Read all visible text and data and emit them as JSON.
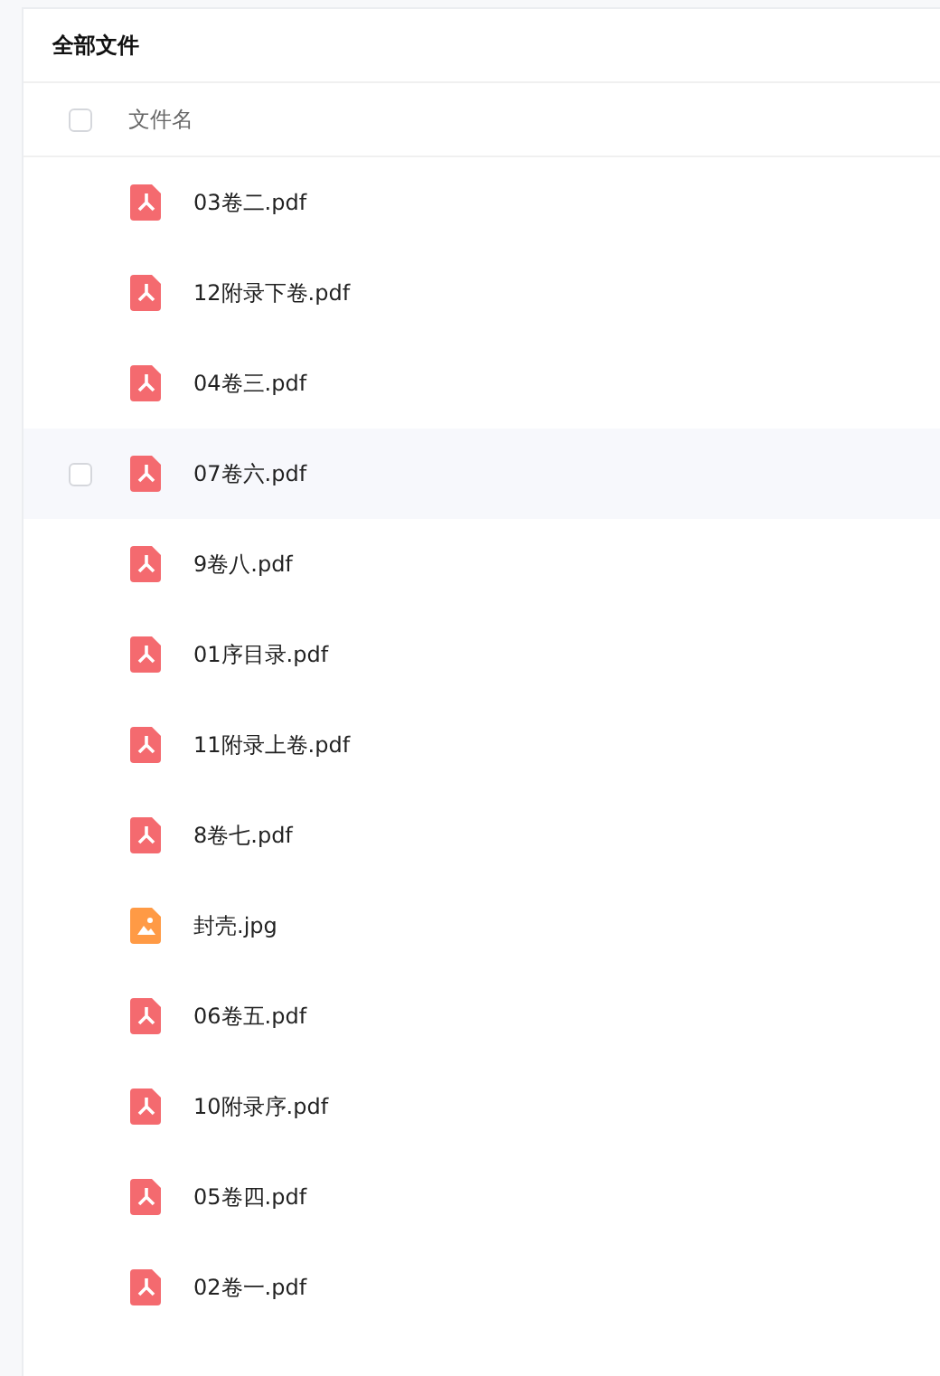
{
  "title": "全部文件",
  "header": {
    "checked": false,
    "column": "文件名"
  },
  "files": [
    {
      "name": "03卷二.pdf",
      "kind": "pdf",
      "hovered": false
    },
    {
      "name": "12附录下卷.pdf",
      "kind": "pdf",
      "hovered": false
    },
    {
      "name": "04卷三.pdf",
      "kind": "pdf",
      "hovered": false
    },
    {
      "name": "07卷六.pdf",
      "kind": "pdf",
      "hovered": true
    },
    {
      "name": "9卷八.pdf",
      "kind": "pdf",
      "hovered": false
    },
    {
      "name": "01序目录.pdf",
      "kind": "pdf",
      "hovered": false
    },
    {
      "name": "11附录上卷.pdf",
      "kind": "pdf",
      "hovered": false
    },
    {
      "name": "8卷七.pdf",
      "kind": "pdf",
      "hovered": false
    },
    {
      "name": "封壳.jpg",
      "kind": "image",
      "hovered": false
    },
    {
      "name": "06卷五.pdf",
      "kind": "pdf",
      "hovered": false
    },
    {
      "name": "10附录序.pdf",
      "kind": "pdf",
      "hovered": false
    },
    {
      "name": "05卷四.pdf",
      "kind": "pdf",
      "hovered": false
    },
    {
      "name": "02卷一.pdf",
      "kind": "pdf",
      "hovered": false
    }
  ]
}
